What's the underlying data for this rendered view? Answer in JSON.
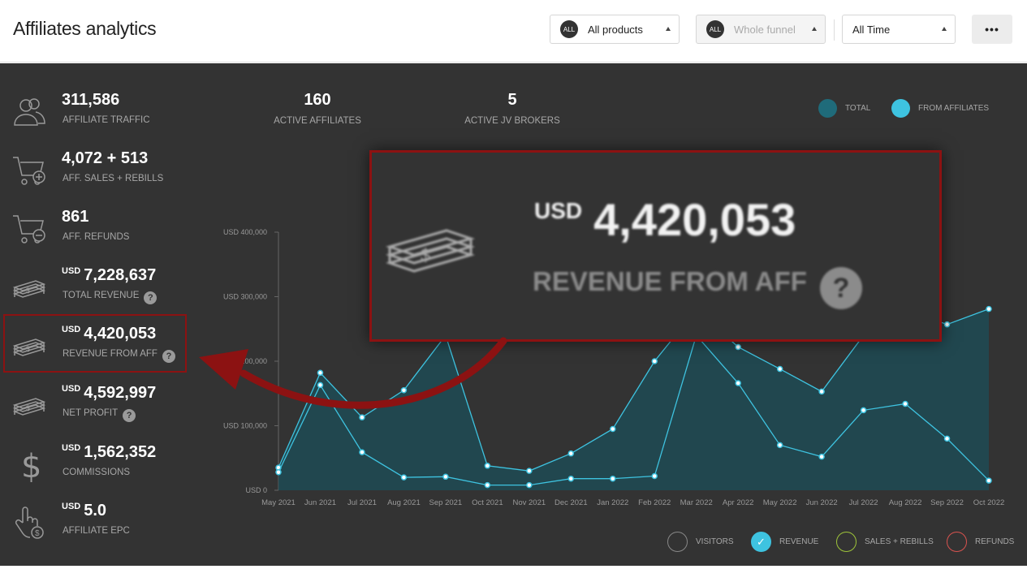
{
  "header": {
    "title": "Affiliates analytics",
    "products_filter": {
      "badge": "ALL",
      "value": "All products"
    },
    "funnel_filter": {
      "badge": "ALL",
      "value": "Whole funnel"
    },
    "time_filter": {
      "value": "All Time"
    },
    "more_label": "•••"
  },
  "stats": [
    {
      "value": "311,586",
      "label": "AFFILIATE TRAFFIC",
      "icon": "users-icon"
    },
    {
      "value": "4,072 + 513",
      "label": "AFF. SALES + REBILLS",
      "icon": "cart-plus-icon"
    },
    {
      "value": "861",
      "label": "AFF. REFUNDS",
      "icon": "cart-minus-icon"
    },
    {
      "currency": "USD",
      "value": "7,228,637",
      "label": "TOTAL REVENUE",
      "icon": "money-stack-icon",
      "help": "?"
    },
    {
      "currency": "USD",
      "value": "4,420,053",
      "label": "REVENUE FROM AFF",
      "icon": "money-stack-icon",
      "help": "?"
    },
    {
      "currency": "USD",
      "value": "4,592,997",
      "label": "NET PROFIT",
      "icon": "money-stack-icon",
      "help": "?"
    },
    {
      "currency": "USD",
      "value": "1,562,352",
      "label": "COMMISSIONS",
      "icon": "dollar-sign-icon"
    },
    {
      "currency": "USD",
      "value": "5.0",
      "label": "AFFILIATE EPC",
      "icon": "hand-click-icon"
    }
  ],
  "kpis": {
    "active_affiliates": {
      "value": "160",
      "label": "ACTIVE AFFILIATES"
    },
    "active_jv_brokers": {
      "value": "5",
      "label": "ACTIVE JV BROKERS"
    }
  },
  "top_legend": {
    "total": {
      "label": "TOTAL",
      "color": "#1f6b7a"
    },
    "from_affiliates": {
      "label": "FROM AFFILIATES",
      "color": "#3ec3e0"
    }
  },
  "zoom_callout": {
    "currency": "USD",
    "value": "4,420,053",
    "label": "REVENUE FROM AFF",
    "help": "?"
  },
  "bottom_legend": {
    "visitors": {
      "label": "VISITORS",
      "color": "#888888"
    },
    "revenue": {
      "label": "REVENUE",
      "color": "#3ec3e0",
      "checked": true
    },
    "sales": {
      "label": "SALES + REBILLS",
      "color": "#9ec43a"
    },
    "refunds": {
      "label": "REFUNDS",
      "color": "#d9534f"
    }
  },
  "chart_data": {
    "type": "area",
    "x": [
      "May 2021",
      "Jun 2021",
      "Jul 2021",
      "Aug 2021",
      "Sep 2021",
      "Oct 2021",
      "Nov 2021",
      "Dec 2021",
      "Jan 2022",
      "Feb 2022",
      "Mar 2022",
      "Apr 2022",
      "May 2022",
      "Jun 2022",
      "Jul 2022",
      "Aug 2022",
      "Sep 2022",
      "Oct 2022"
    ],
    "y_ticks": [
      "USD 0",
      "USD 100,000",
      "USD 200,000",
      "USD 300,000",
      "USD 400,000"
    ],
    "ylim": [
      0,
      400000
    ],
    "series": [
      {
        "name": "TOTAL",
        "values": [
          35000,
          182000,
          113000,
          155000,
          240000,
          38000,
          30000,
          57000,
          95000,
          200000,
          280000,
          222000,
          188000,
          153000,
          240000,
          280000,
          257000,
          281000
        ]
      },
      {
        "name": "FROM AFFILIATES",
        "values": [
          28000,
          163000,
          59000,
          20000,
          21000,
          8000,
          8000,
          18000,
          18000,
          22000,
          240000,
          166000,
          70000,
          52000,
          124000,
          134000,
          80000,
          15000
        ]
      }
    ],
    "colors": {
      "area": "#1f4b55",
      "line": "#3ec3e0"
    },
    "grid": false
  }
}
